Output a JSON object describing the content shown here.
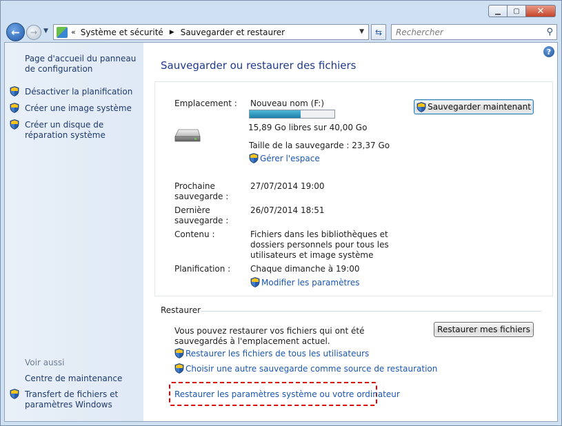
{
  "nav": {
    "breadcrumb": [
      "Système et sécurité",
      "Sauvegarder et restaurer"
    ],
    "search_placeholder": "Rechercher"
  },
  "sidebar": {
    "home_link": "Page d'accueil du panneau de configuration",
    "items": [
      {
        "label": "Désactiver la planification",
        "icon": "shield-icon"
      },
      {
        "label": "Créer une image système",
        "icon": "shield-icon"
      },
      {
        "label": "Créer un disque de réparation système",
        "icon": "shield-icon"
      }
    ],
    "see_also_title": "Voir aussi",
    "see_also": [
      {
        "label": "Centre de maintenance"
      },
      {
        "label": "Transfert de fichiers et paramètres Windows",
        "icon": "shield-icon"
      }
    ]
  },
  "main": {
    "title": "Sauvegarder ou restaurer des fichiers",
    "backup": {
      "location_label": "Emplacement :",
      "location_value": "Nouveau nom (F:)",
      "disk_usage_fraction": 0.6,
      "free_space": "15,89 Go libres sur 40,00 Go",
      "backup_size": "Taille de la sauvegarde : 23,37 Go",
      "manage_space_link": "Gérer l'espace",
      "backup_now_button": "Sauvegarder maintenant",
      "next_backup_label": "Prochaine sauvegarde :",
      "next_backup_value": "27/07/2014 19:00",
      "last_backup_label": "Dernière sauvegarde :",
      "last_backup_value": "26/07/2014 18:51",
      "contents_label": "Contenu :",
      "contents_value": "Fichiers dans les bibliothèques et dossiers personnels pour tous les utilisateurs et image système",
      "schedule_label": "Planification :",
      "schedule_value": "Chaque dimanche à 19:00",
      "change_settings_link": "Modifier les paramètres"
    },
    "restore": {
      "section_title": "Restaurer",
      "description": "Vous pouvez restaurer vos fichiers qui ont été sauvegardés à l'emplacement actuel.",
      "restore_button": "Restaurer mes fichiers",
      "all_users_link": "Restaurer les fichiers de tous les utilisateurs",
      "other_backup_link": "Choisir une autre sauvegarde comme source de restauration",
      "system_settings_link": "Restaurer les paramètres système ou votre ordinateur"
    }
  },
  "colors": {
    "link": "#1a56b0",
    "title": "#1e3a8a",
    "highlight_border": "#e00000",
    "progress_fill": "#1c7fa8"
  }
}
